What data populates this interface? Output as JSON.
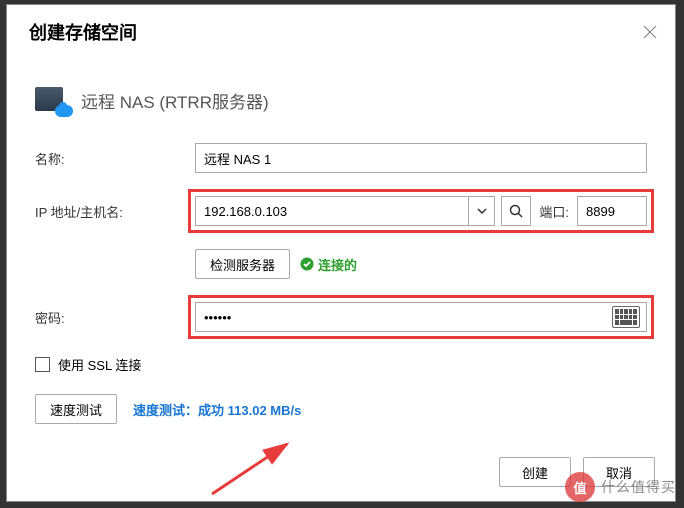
{
  "dialog": {
    "title": "创建存储空间",
    "section_title": "远程 NAS (RTRR服务器)"
  },
  "form": {
    "name_label": "名称:",
    "name_value": "远程 NAS 1",
    "ip_label": "IP 地址/主机名:",
    "ip_value": "192.168.0.103",
    "port_label": "端口:",
    "port_value": "8899",
    "detect_btn": "检测服务器",
    "detect_status": "连接的",
    "password_label": "密码:",
    "password_value": "••••••",
    "ssl_label": "使用 SSL 连接",
    "speed_test_btn": "速度测试",
    "speed_result": "速度测试：成功 113.02 MB/s"
  },
  "footer": {
    "create": "创建",
    "cancel": "取消"
  },
  "watermark": {
    "badge": "值",
    "text": "什么值得买"
  },
  "colors": {
    "highlight_border": "#e83c3c",
    "link_blue": "#1976d2",
    "success_green": "#2e9e2e"
  }
}
